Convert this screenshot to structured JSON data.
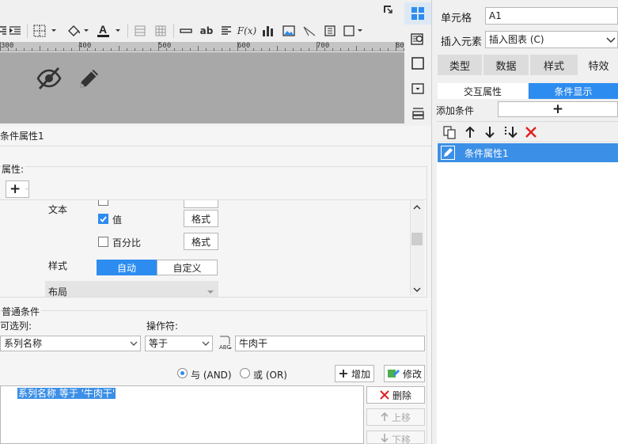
{
  "toolbar": {
    "ruler_ticks": [
      "300",
      "400",
      "500",
      "600",
      "700",
      "80"
    ]
  },
  "right_panel": {
    "cell_label": "单元格",
    "cell_value": "A1",
    "insert_label": "插入元素",
    "insert_value": "插入图表 (C)",
    "tabs": [
      "类型",
      "数据",
      "样式",
      "特效"
    ],
    "subtabs": [
      "交互属性",
      "条件显示"
    ],
    "add_condition_label": "添加条件",
    "add_icon": "+",
    "condition_items": [
      "条件属性1"
    ]
  },
  "dialog": {
    "title": "条件属性1",
    "attr_label": "属性:",
    "add_attr_icon": "+",
    "rows": {
      "text_label": "文本",
      "value_label": "值",
      "value_checked": true,
      "percent_label": "百分比",
      "percent_checked": false,
      "format_label": "格式",
      "style_label": "样式",
      "style_auto": "自动",
      "style_custom": "自定义",
      "layout_label": "布局"
    },
    "normal_condition_label": "普通条件",
    "optional_column_label": "可选列:",
    "operator_label": "操作符:",
    "column_value": "系列名称",
    "operator_value": "等于",
    "condition_value": "牛肉干",
    "and_label": "与 (AND)",
    "or_label": "或 (OR)",
    "logic_selected": "and",
    "add_button": "增加",
    "modify_button": "修改",
    "delete_button": "删除",
    "up_button": "上移",
    "down_button": "下移",
    "condition_text": "系列名称 等于 '牛肉干'"
  },
  "colors": {
    "accent": "#2d8cf0",
    "selected_row": "#3c8fe6",
    "canvas": "#a8a8a8",
    "delete_red": "#e02020"
  }
}
